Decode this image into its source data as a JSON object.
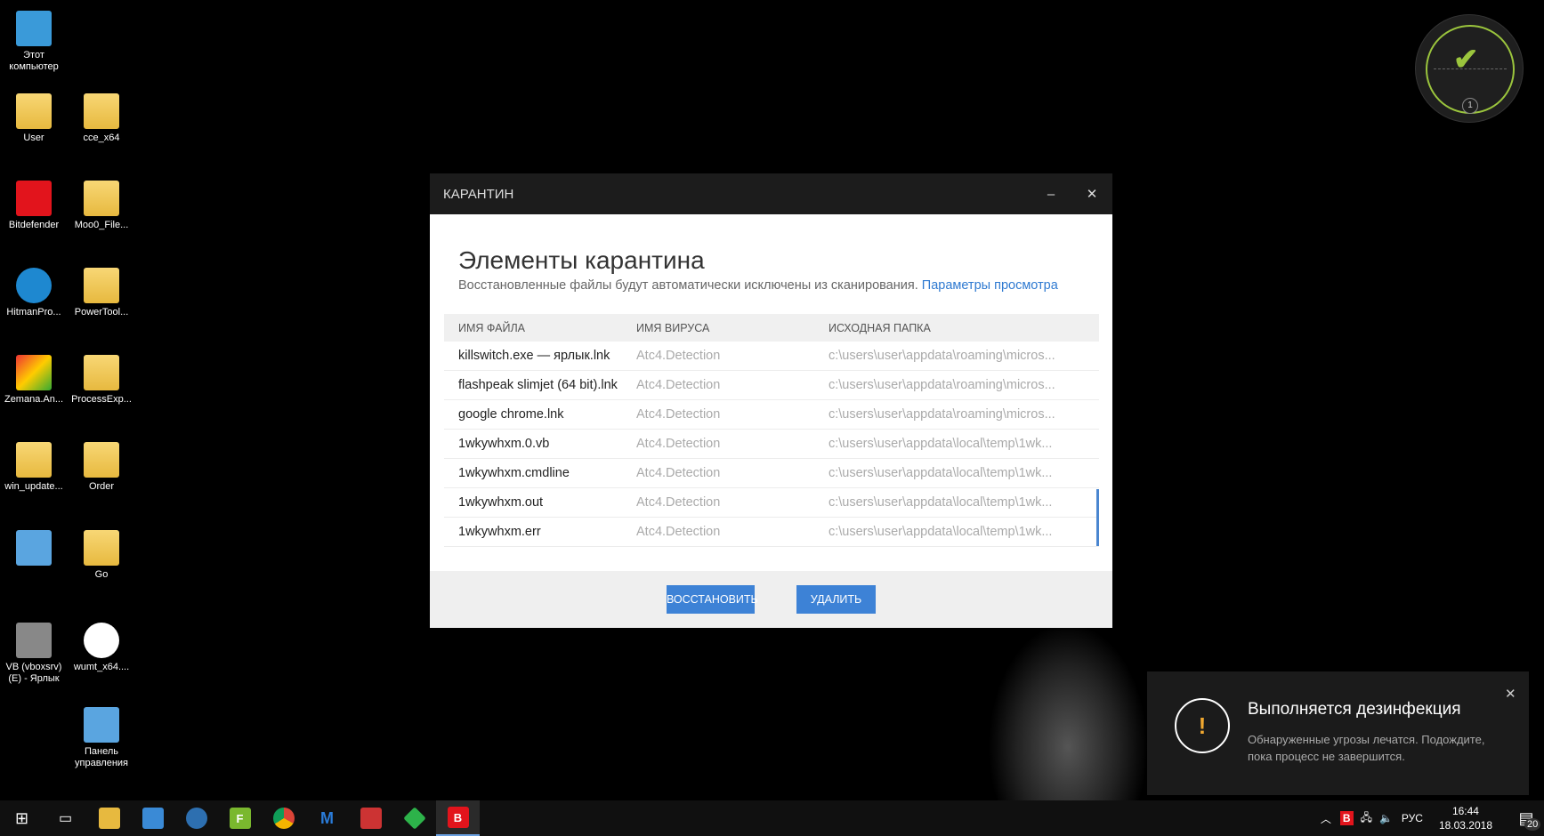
{
  "desktop": {
    "icons": [
      {
        "label": "Этот компьютер",
        "type": "pc"
      },
      {
        "label": "User",
        "type": "folder"
      },
      {
        "label": "cce_x64",
        "type": "folder"
      },
      {
        "label": "Bitdefender",
        "type": "bitdefender"
      },
      {
        "label": "Moo0_File...",
        "type": "folder"
      },
      {
        "label": "HitmanPro...",
        "type": "hitman"
      },
      {
        "label": "PowerTool...",
        "type": "folder"
      },
      {
        "label": "Zemana.An...",
        "type": "zemana"
      },
      {
        "label": "ProcessExp...",
        "type": "folder"
      },
      {
        "label": "win_update...",
        "type": "folder"
      },
      {
        "label": "Order",
        "type": "folder"
      },
      {
        "label": "",
        "type": "control"
      },
      {
        "label": "Go",
        "type": "folder"
      },
      {
        "label": "VB (vboxsrv) (E) - Ярлык",
        "type": "drive"
      },
      {
        "label": "wumt_x64....",
        "type": "wumt"
      },
      {
        "label": "Панель управления",
        "type": "control"
      }
    ]
  },
  "gauge": {
    "count": "1",
    "status": "ok"
  },
  "dialog": {
    "title": "КАРАНТИН",
    "heading": "Элементы карантина",
    "subtitle": "Восстановленные файлы будут автоматически исключены из сканирования.",
    "link": "Параметры просмотра",
    "columns": [
      "ИМЯ ФАЙЛА",
      "ИМЯ ВИРУСА",
      "ИСХОДНАЯ ПАПКА"
    ],
    "rows": [
      [
        "killswitch.exe — ярлык.lnk",
        "Atc4.Detection",
        "c:\\users\\user\\appdata\\roaming\\micros..."
      ],
      [
        "flashpeak slimjet (64 bit).lnk",
        "Atc4.Detection",
        "c:\\users\\user\\appdata\\roaming\\micros..."
      ],
      [
        "google chrome.lnk",
        "Atc4.Detection",
        "c:\\users\\user\\appdata\\roaming\\micros..."
      ],
      [
        "1wkywhxm.0.vb",
        "Atc4.Detection",
        "c:\\users\\user\\appdata\\local\\temp\\1wk..."
      ],
      [
        "1wkywhxm.cmdline",
        "Atc4.Detection",
        "c:\\users\\user\\appdata\\local\\temp\\1wk..."
      ],
      [
        "1wkywhxm.out",
        "Atc4.Detection",
        "c:\\users\\user\\appdata\\local\\temp\\1wk..."
      ],
      [
        "1wkywhxm.err",
        "Atc4.Detection",
        "c:\\users\\user\\appdata\\local\\temp\\1wk..."
      ]
    ],
    "restore": "ВОССТАНОВИТЬ",
    "delete": "УДАЛИТЬ"
  },
  "toast": {
    "title": "Выполняется дезинфекция",
    "message": "Обнаруженные угрозы лечатся. Подождите, пока процесс не завершится."
  },
  "tray": {
    "lang": "РУС",
    "time": "16:44",
    "date": "18.03.2018",
    "notifications": "20"
  },
  "colors": {
    "accent": "#3d82d6",
    "link": "#2f7ad1",
    "gauge": "#9bc53d",
    "warning": "#f0a830"
  }
}
